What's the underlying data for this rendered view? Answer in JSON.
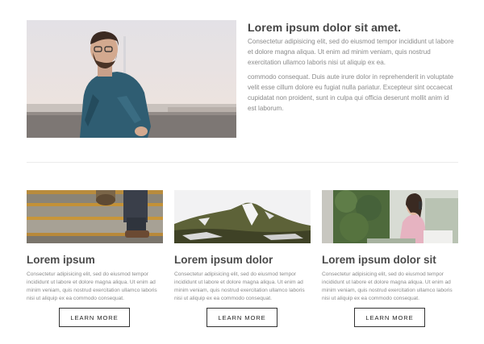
{
  "feature": {
    "title": "Lorem ipsum dolor sit amet.",
    "paragraph_1": "Consectetur adipisicing elit, sed do eiusmod tempor incididunt ut labore et dolore magna aliqua. Ut enim ad minim veniam, quis nostrud exercitation ullamco laboris nisi ut aliquip ex ea.",
    "paragraph_2": "commodo consequat. Duis aute irure dolor in reprehenderit in voluptate velit esse cillum dolore eu fugiat nulla pariatur. Excepteur sint occaecat cupidatat non proident, sunt in culpa qui officia deserunt mollit anim id est laborum."
  },
  "cards": [
    {
      "title": "Lorem ipsum",
      "body": "Consectetur adipisicing elit, sed do eiusmod tempor incididunt ut labore et dolore magna aliqua. Ut enim ad minim veniam, quis nostrud exercitation ullamco laboris nisi ut aliquip ex ea commodo consequat.",
      "button": "LEARN MORE"
    },
    {
      "title": "Lorem ipsum dolor",
      "body": "Consectetur adipisicing elit, sed do eiusmod tempor incididunt ut labore et dolore magna aliqua. Ut enim ad minim veniam, quis nostrud exercitation ullamco laboris nisi ut aliquip ex ea commodo consequat.",
      "button": "LEARN MORE"
    },
    {
      "title": "Lorem ipsum dolor sit",
      "body": "Consectetur adipisicing elit, sed do eiusmod tempor incididunt ut labore et dolore magna aliqua. Ut enim ad minim veniam, quis nostrud exercitation ullamco laboris nisi ut aliquip ex ea commodo consequat.",
      "button": "LEARN MORE"
    }
  ],
  "colors": {
    "text_heading": "#444444",
    "text_body": "#8a8a8a",
    "button_border": "#333333",
    "divider": "#ececec"
  }
}
